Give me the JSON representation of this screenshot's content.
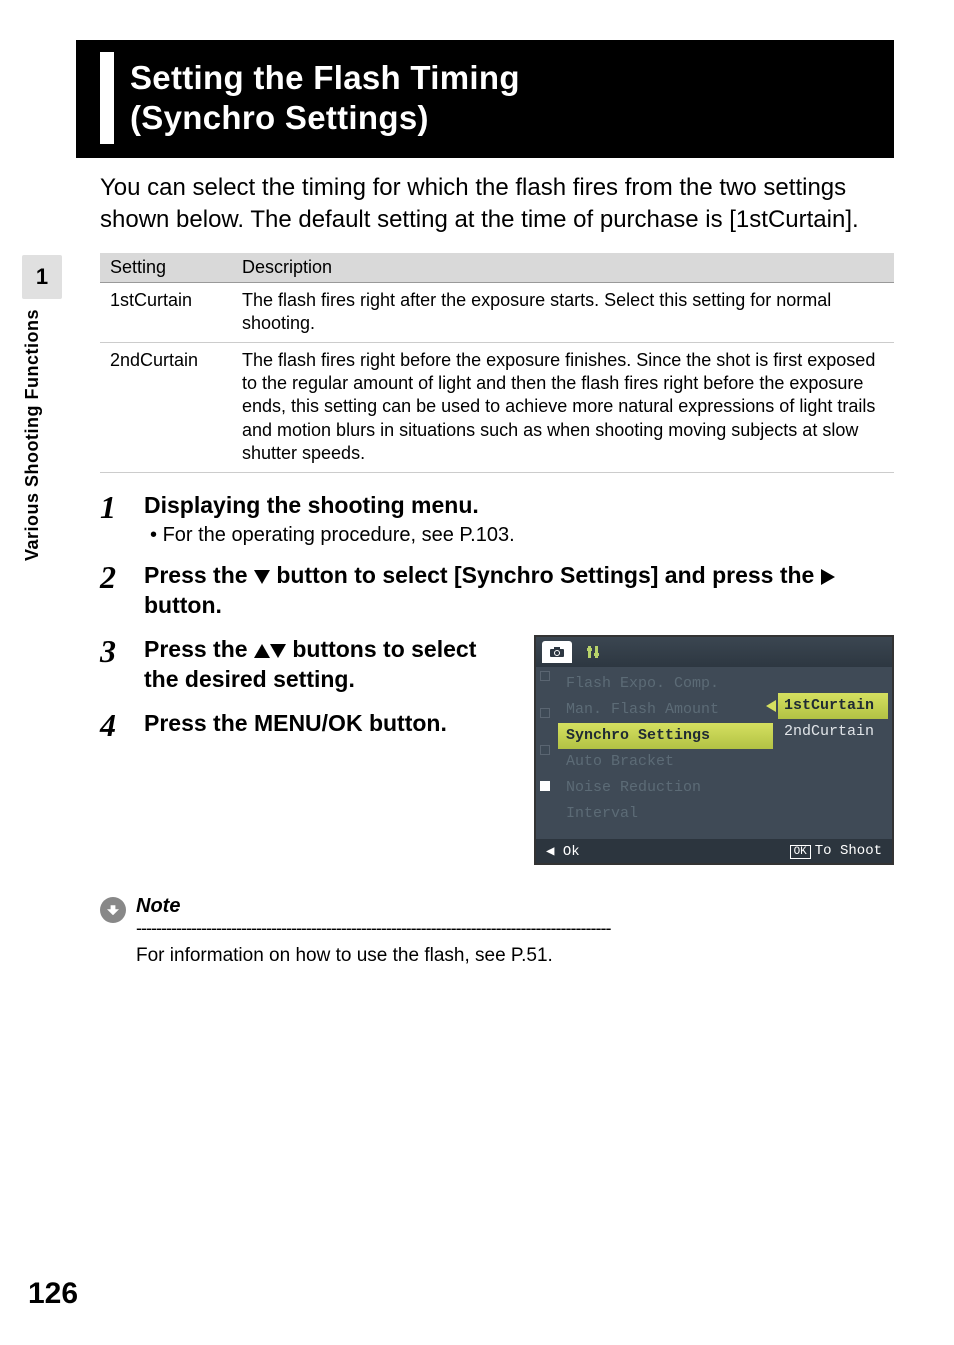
{
  "side_tab": {
    "number": "1",
    "label": "Various Shooting Functions"
  },
  "heading": {
    "line1": "Setting the Flash Timing",
    "line2": "(Synchro Settings)"
  },
  "intro": "You can select the timing for which the flash fires from the two settings shown below. The default setting at the time of purchase is [1stCurtain].",
  "table": {
    "headers": {
      "setting": "Setting",
      "description": "Description"
    },
    "rows": [
      {
        "setting": "1stCurtain",
        "description": "The flash fires right after the exposure starts. Select this setting for normal shooting."
      },
      {
        "setting": "2ndCurtain",
        "description": "The flash fires right before the exposure finishes. Since the shot is first exposed to the regular amount of light and then the flash fires right before the exposure ends, this setting can be used to achieve more natural expressions of light trails and motion blurs in situations such as when shooting moving subjects at slow shutter speeds."
      }
    ]
  },
  "steps": {
    "s1": {
      "num": "1",
      "title": "Displaying the shooting menu.",
      "sub": "For the operating procedure, see P.103."
    },
    "s2": {
      "num": "2",
      "title_a": "Press the ",
      "title_b": " button to select [Synchro Settings] and press the ",
      "title_c": " button."
    },
    "s3": {
      "num": "3",
      "title_a": "Press the ",
      "title_b": " buttons to select the desired setting."
    },
    "s4": {
      "num": "4",
      "title": "Press the MENU/OK button."
    }
  },
  "lcd": {
    "menu": {
      "flash_expo": "Flash Expo. Comp.",
      "man_flash": "Man. Flash Amount",
      "synchro": "Synchro Settings",
      "auto_bracket": "Auto Bracket",
      "noise": "Noise Reduction",
      "interval": "Interval"
    },
    "options": {
      "opt1": "1stCurtain",
      "opt2": "2ndCurtain"
    },
    "footer": {
      "ok_left": "Ok",
      "ok_btn": "OK",
      "to_shoot": "To Shoot"
    }
  },
  "note": {
    "label": "Note",
    "dashes": "-----------------------------------------------------------------------------------------------",
    "text": "For information on how to use the flash, see P.51."
  },
  "page_number": "126"
}
